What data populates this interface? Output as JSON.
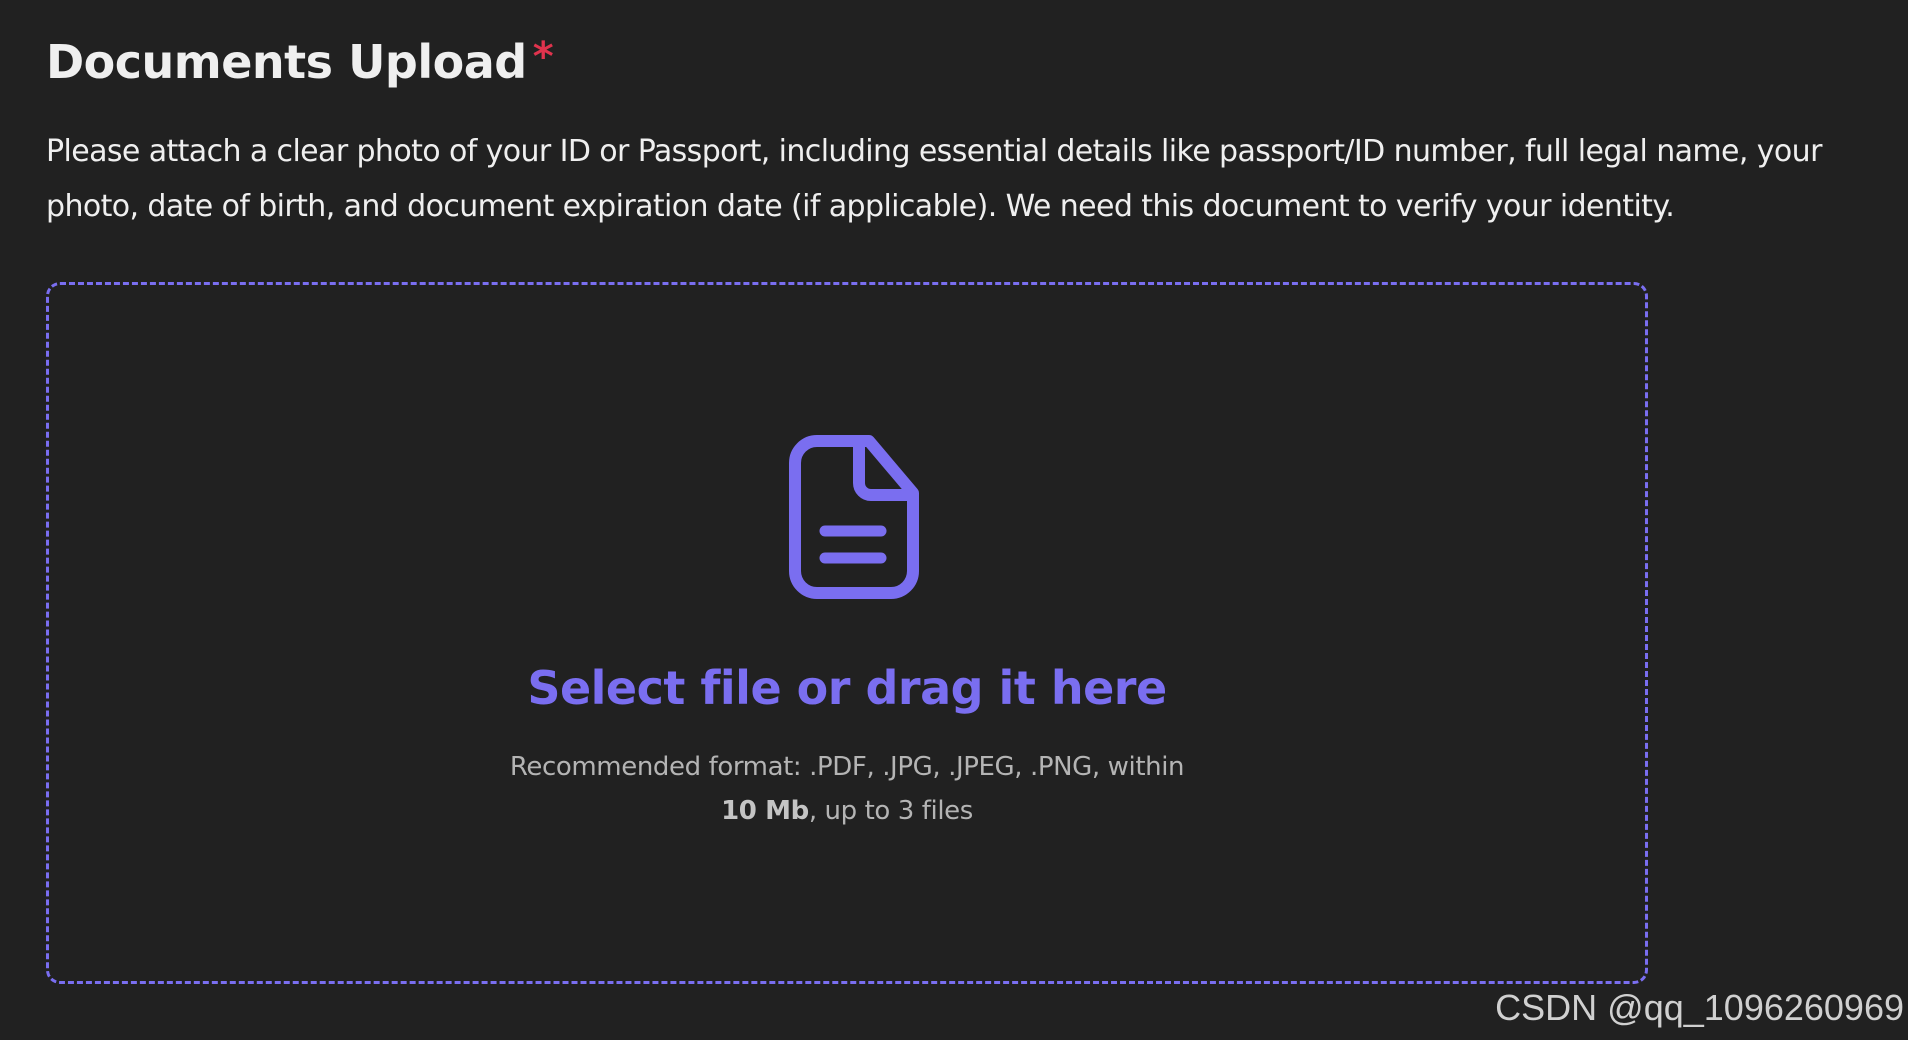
{
  "header": {
    "title": "Documents Upload",
    "required_marker": "*"
  },
  "description": {
    "text": "Please attach a clear photo of your ID or Passport, including essential details like passport/ID number, full legal name, your photo, date of birth, and document expiration date (if applicable). We need this document to verify your identity."
  },
  "dropzone": {
    "icon": "file-document-icon",
    "cta_label": "Select file or drag it here",
    "hint_line1": "Recommended format: .PDF, .JPG, .JPEG, .PNG, within",
    "hint_size": "10 Mb",
    "hint_line2_rest": ", up to 3 files"
  },
  "watermark": {
    "text": "CSDN @qq_1096260969"
  },
  "colors": {
    "background": "#212121",
    "accent": "#7a6ef0",
    "required": "#e0334d",
    "text": "#efefef",
    "muted_text": "#b4b4b4"
  }
}
